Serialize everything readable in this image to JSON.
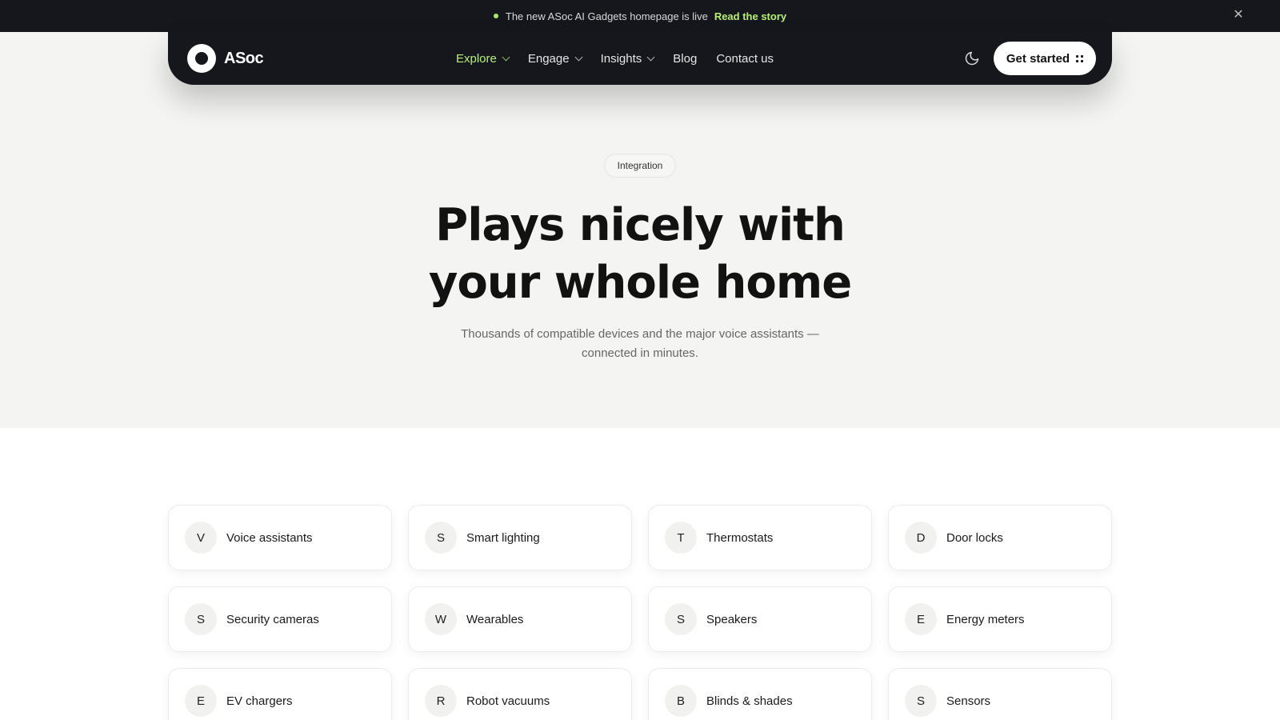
{
  "announcement": {
    "text": "The new ASoc AI Gadgets homepage is live",
    "link": "Read the story",
    "close": "✕"
  },
  "nav": {
    "logo": "ASoc",
    "links": [
      {
        "label": "Explore",
        "dropdown": true,
        "active": true
      },
      {
        "label": "Engage",
        "dropdown": true
      },
      {
        "label": "Insights",
        "dropdown": true
      },
      {
        "label": "Blog",
        "dropdown": false
      },
      {
        "label": "Contact us",
        "dropdown": false
      }
    ],
    "cta": "Get started"
  },
  "hero": {
    "tag": "Integration",
    "title_line1": "Plays nicely with",
    "title_line2": "your whole home",
    "subtitle": "Thousands of compatible devices and the major voice assistants — connected in minutes."
  },
  "integrations": [
    {
      "initial": "V",
      "label": "Voice assistants"
    },
    {
      "initial": "S",
      "label": "Smart lighting"
    },
    {
      "initial": "T",
      "label": "Thermostats"
    },
    {
      "initial": "D",
      "label": "Door locks"
    },
    {
      "initial": "S",
      "label": "Security cameras"
    },
    {
      "initial": "W",
      "label": "Wearables"
    },
    {
      "initial": "S",
      "label": "Speakers"
    },
    {
      "initial": "E",
      "label": "Energy meters"
    },
    {
      "initial": "E",
      "label": "EV chargers"
    },
    {
      "initial": "R",
      "label": "Robot vacuums"
    },
    {
      "initial": "B",
      "label": "Blinds & shades"
    },
    {
      "initial": "S",
      "label": "Sensors"
    }
  ],
  "colors": {
    "accent": "#b8ef7a",
    "dark": "#15171c"
  }
}
